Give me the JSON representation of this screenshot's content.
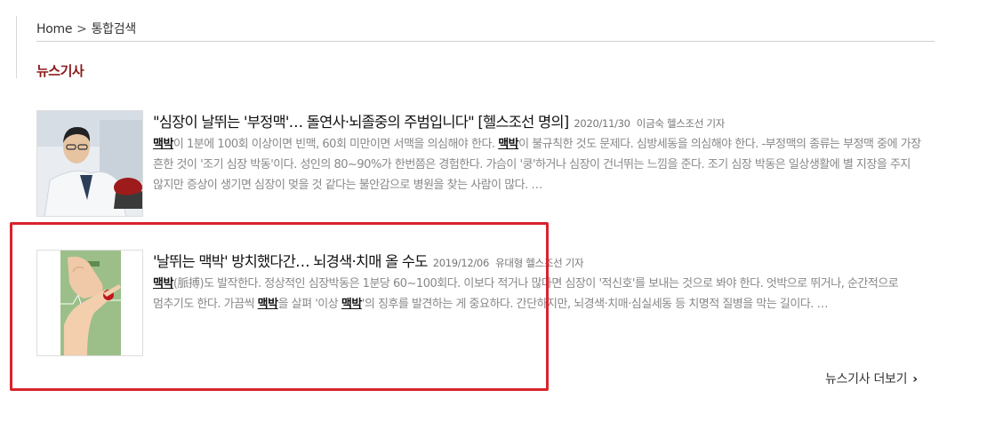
{
  "breadcrumb": {
    "home": "Home",
    "separator": ">",
    "current": "통합검색"
  },
  "section_title": "뉴스기사",
  "articles": [
    {
      "title": "\"심장이 날뛰는 '부정맥'… 돌연사·뇌졸중의 주범입니다\" [헬스조선 명의]",
      "date": "2020/11/30",
      "author": "이금숙 헬스조선 기자",
      "snippet": [
        {
          "t": "맥박",
          "hl": true
        },
        {
          "t": "이 1분에 100회 이상이면 빈맥, 60회 미만이면 서맥을 의심해야 한다. ",
          "hl": false
        },
        {
          "t": "맥박",
          "hl": true
        },
        {
          "t": "이 불규칙한 것도 문제다. 심방세동을 의심해야 한다. -부정맥의 종류는 부정맥 중에 가장 흔한 것이 '조기 심장 박동'이다. 성인의 80~90%가 한번쯤은 경험한다. 가슴이 '쿵'하거나 심장이 건너뛰는 느낌을 준다. 조기 심장 박동은 일상생활에 별 지장을 주지 않지만 증상이 생기면 심장이 멎을 것 같다는 불안감으로 병원을 찾는 사람이 많다. …",
          "hl": false
        }
      ]
    },
    {
      "title": "'날뛰는 맥박' 방치했다간… 뇌경색·치매 올 수도",
      "date": "2019/12/06",
      "author": "유대형 헬스조선 기자",
      "snippet": [
        {
          "t": "맥박",
          "hl": true
        },
        {
          "t": "(脈搏)도 발작한다. 정상적인 심장박동은 1분당 60~100회다. 이보다 적거나 많다면 심장이 '적신호'를 보내는 것으로 봐야 한다. 엇박으로 뛰거나, 순간적으로 멈추기도 한다. 가끔씩 ",
          "hl": false
        },
        {
          "t": "맥박",
          "hl": true
        },
        {
          "t": "을 살펴 '이상 ",
          "hl": false
        },
        {
          "t": "맥박",
          "hl": true
        },
        {
          "t": "'의 징후를 발견하는 게 중요하다. 간단하지만, 뇌경색·치매·심실세동 등 치명적 질병을 막는 길이다. …",
          "hl": false
        }
      ]
    }
  ],
  "more_link": "뉴스기사 더보기",
  "more_icon": "chevron-right-icon",
  "colors": {
    "section_title": "#8b1a1a",
    "highlight_box": "#d9232d"
  }
}
